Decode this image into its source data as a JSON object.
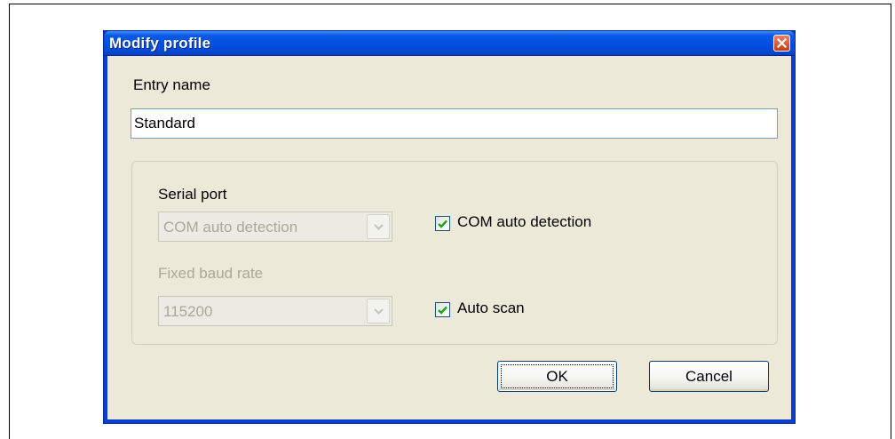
{
  "window": {
    "title": "Modify profile",
    "close_icon": "close-icon"
  },
  "entry": {
    "label": "Entry name",
    "value": "Standard"
  },
  "serial_port": {
    "label": "Serial port",
    "selected": "COM auto detection",
    "disabled": true
  },
  "baud_rate": {
    "label": "Fixed baud rate",
    "selected": "115200",
    "disabled": true
  },
  "com_auto_detection": {
    "label": "COM auto detection",
    "checked": true
  },
  "auto_scan": {
    "label": "Auto scan",
    "checked": true
  },
  "buttons": {
    "ok": "OK",
    "cancel": "Cancel"
  },
  "colors": {
    "titlebar": "#0450e0",
    "dialog_bg": "#ece9d8",
    "disabled_text": "#aca899",
    "checkmark": "#21a121"
  }
}
